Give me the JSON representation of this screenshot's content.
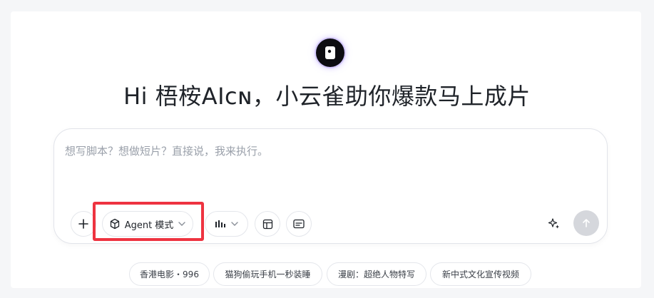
{
  "logo": {
    "icon": "camera-logo-icon"
  },
  "headline": "Hi 梧桉AIᴄɴ，小云雀助你爆款马上成片",
  "input": {
    "placeholder": "想写脚本？想做短片？直接说，我来执行。",
    "value": ""
  },
  "toolbar": {
    "add_icon": "plus-icon",
    "agent_mode_label": "Agent 模式",
    "agent_mode_icon": "cube-icon",
    "chart_icon": "bar-chart-icon",
    "layout_icon": "layout-icon",
    "caption_icon": "subtitle-icon",
    "sparkle_icon": "sparkle-icon",
    "send_icon": "arrow-up-icon"
  },
  "suggestions": [
    {
      "label": "香港电影・996"
    },
    {
      "label": "猫狗偷玩手机一秒装睡"
    },
    {
      "label": "漫剧：超绝人物特写"
    },
    {
      "label": "新中式文化宣传视频"
    }
  ],
  "colors": {
    "highlight": "#ee3340",
    "send_disabled": "#d5d7dc",
    "logo_bg": "#0d0d12"
  }
}
